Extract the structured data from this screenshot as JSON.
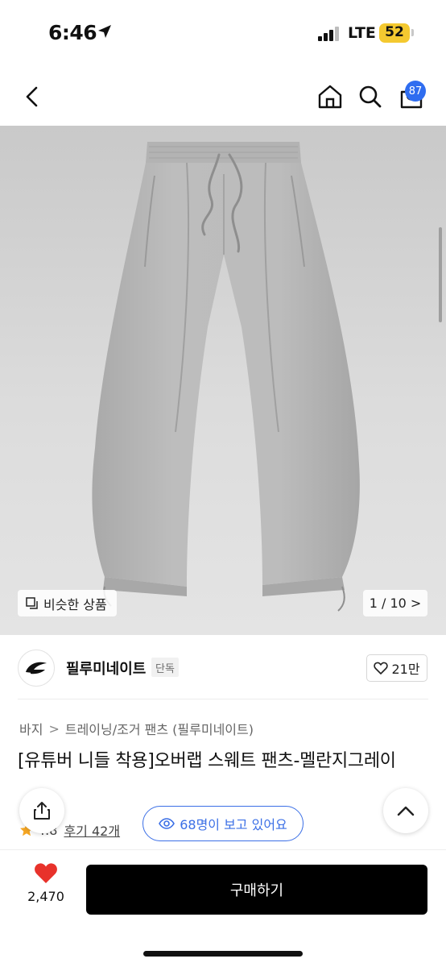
{
  "status_bar": {
    "time": "6:46",
    "network": "LTE",
    "battery": "52"
  },
  "header": {
    "cart_count": "87",
    "icons": [
      "back-icon",
      "home-icon",
      "search-icon",
      "cart-icon"
    ]
  },
  "gallery": {
    "similar_label": "비슷한 상품",
    "page_indicator": "1 / 10 >"
  },
  "brand": {
    "name": "필루미네이트",
    "tag": "단독",
    "likes": "21만"
  },
  "breadcrumb": {
    "category": "바지",
    "separator": ">",
    "sub": "트레이닝/조거 팬츠 (필루미네이트)"
  },
  "product": {
    "title": "[유튜버 니들 착용]오버랩 스웨트 팬츠-멜란지그레이",
    "rating": "4.8",
    "reviews": "후기 42개",
    "viewers": "68명이 보고 있어요"
  },
  "actions": {
    "wish_count": "2,470",
    "buy_label": "구매하기"
  },
  "colors": {
    "accent_blue": "#3b6fe6",
    "badge_blue": "#2f6df0",
    "heart_red": "#e8322b",
    "star": "#f5a623"
  }
}
